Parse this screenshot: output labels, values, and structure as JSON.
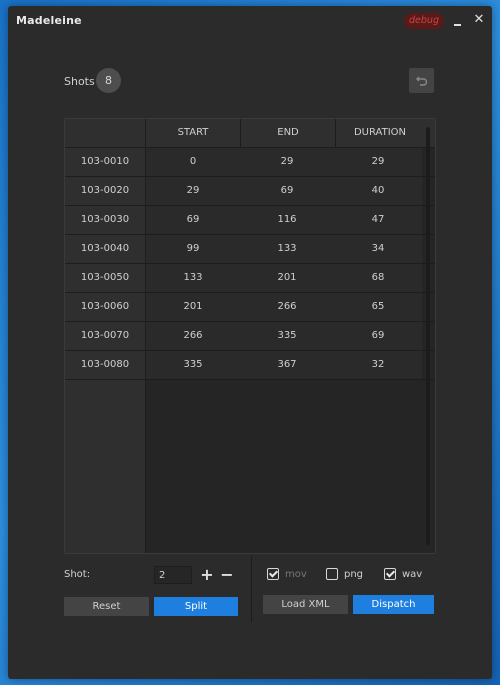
{
  "window": {
    "title": "Madeleine",
    "badge": "debug",
    "close_symbol": "✕"
  },
  "shots": {
    "label": "Shots",
    "count": "8"
  },
  "table": {
    "columns": [
      "START",
      "END",
      "DURATION"
    ],
    "rows": [
      {
        "name": "103-0010",
        "start": "0",
        "end": "29",
        "duration": "29"
      },
      {
        "name": "103-0020",
        "start": "29",
        "end": "69",
        "duration": "40"
      },
      {
        "name": "103-0030",
        "start": "69",
        "end": "116",
        "duration": "47"
      },
      {
        "name": "103-0040",
        "start": "99",
        "end": "133",
        "duration": "34"
      },
      {
        "name": "103-0050",
        "start": "133",
        "end": "201",
        "duration": "68"
      },
      {
        "name": "103-0060",
        "start": "201",
        "end": "266",
        "duration": "65"
      },
      {
        "name": "103-0070",
        "start": "266",
        "end": "335",
        "duration": "69"
      },
      {
        "name": "103-0080",
        "start": "335",
        "end": "367",
        "duration": "32"
      }
    ]
  },
  "controls": {
    "shot_label": "Shot:",
    "shot_value": "2",
    "plus_symbol": "+",
    "minus_symbol": "−",
    "reset_label": "Reset",
    "split_label": "Split",
    "load_label": "Load XML",
    "dispatch_label": "Dispatch",
    "checks": [
      {
        "label": "mov",
        "checked": true,
        "dim": true
      },
      {
        "label": "png",
        "checked": false,
        "dim": false
      },
      {
        "label": "wav",
        "checked": true,
        "dim": false
      }
    ]
  },
  "colors": {
    "accent": "#1f7fdf",
    "background": "#2b2b2b",
    "debug": "#5a1a1a"
  }
}
